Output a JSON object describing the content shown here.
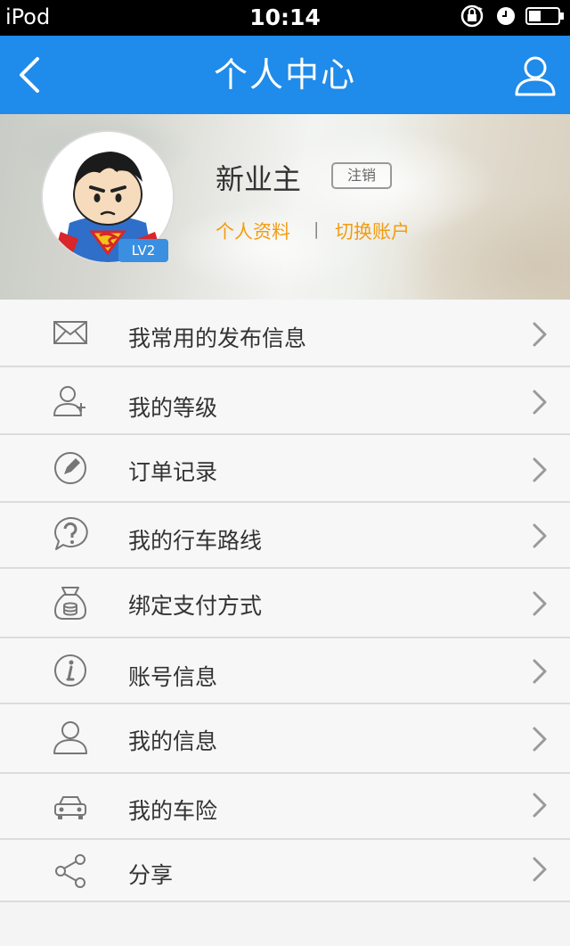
{
  "status_bar": {
    "carrier": "iPod",
    "time": "10:14"
  },
  "nav": {
    "title": "个人中心",
    "back_icon": "chevron-left-icon",
    "user_icon": "user-icon",
    "bar_color": "#1f8bea"
  },
  "profile": {
    "username": "新业主",
    "logout_label": "注销",
    "level": "LV2",
    "link_profile": "个人资料",
    "link_divider": "|",
    "link_switch": "切换账户",
    "link_color": "#f39c12"
  },
  "menu": {
    "items": [
      {
        "label": "我常用的发布信息",
        "icon": "envelope-icon"
      },
      {
        "label": "我的等级",
        "icon": "user-plus-icon"
      },
      {
        "label": "订单记录",
        "icon": "pencil-circle-icon"
      },
      {
        "label": "我的行车路线",
        "icon": "question-bubble-icon"
      },
      {
        "label": "绑定支付方式",
        "icon": "money-bag-icon"
      },
      {
        "label": "账号信息",
        "icon": "info-circle-icon"
      },
      {
        "label": "我的信息",
        "icon": "person-icon"
      },
      {
        "label": "我的车险",
        "icon": "car-icon"
      },
      {
        "label": "分享",
        "icon": "share-icon"
      }
    ]
  }
}
